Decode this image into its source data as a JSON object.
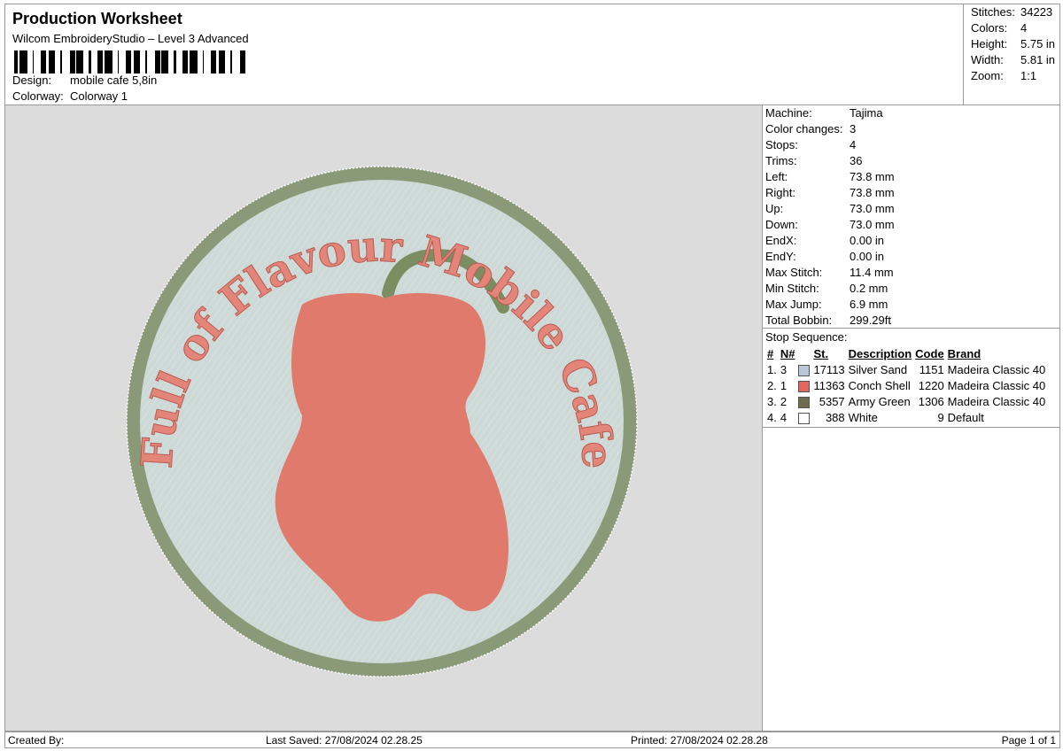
{
  "header": {
    "title": "Production Worksheet",
    "software": "Wilcom EmbroideryStudio – Level 3 Advanced",
    "design_label": "Design:",
    "design_value": "mobile cafe 5,8in",
    "colorway_label": "Colorway:",
    "colorway_value": "Colorway 1"
  },
  "stats": [
    {
      "label": "Stitches:",
      "value": "34223"
    },
    {
      "label": "Colors:",
      "value": "4"
    },
    {
      "label": "Height:",
      "value": "5.75 in"
    },
    {
      "label": "Width:",
      "value": "5.81 in"
    },
    {
      "label": "Zoom:",
      "value": "1:1"
    }
  ],
  "machine": [
    {
      "label": "Machine:",
      "value": "Tajima"
    },
    {
      "label": "Color changes:",
      "value": "3"
    },
    {
      "label": "Stops:",
      "value": "4"
    },
    {
      "label": "Trims:",
      "value": "36"
    },
    {
      "label": "Left:",
      "value": "73.8 mm"
    },
    {
      "label": "Right:",
      "value": "73.8 mm"
    },
    {
      "label": "Up:",
      "value": "73.0 mm"
    },
    {
      "label": "Down:",
      "value": "73.0 mm"
    },
    {
      "label": "EndX:",
      "value": "0.00 in"
    },
    {
      "label": "EndY:",
      "value": "0.00 in"
    },
    {
      "label": "Max Stitch:",
      "value": "11.4 mm"
    },
    {
      "label": "Min Stitch:",
      "value": "0.2 mm"
    },
    {
      "label": "Max Jump:",
      "value": "6.9 mm"
    },
    {
      "label": "Total Bobbin:",
      "value": "299.29ft"
    }
  ],
  "stop_sequence": {
    "title": "Stop Sequence:",
    "headers": {
      "idx": "#",
      "n": "N#",
      "st": "St.",
      "desc": "Description",
      "code": "Code",
      "brand": "Brand"
    },
    "rows": [
      {
        "idx": "1.",
        "n": "3",
        "color": "#b9c7d8",
        "st": "17113",
        "desc": "Silver Sand",
        "code": "1151",
        "brand": "Madeira Classic 40"
      },
      {
        "idx": "2.",
        "n": "1",
        "color": "#e2665e",
        "st": "11363",
        "desc": "Conch Shell",
        "code": "1220",
        "brand": "Madeira Classic 40"
      },
      {
        "idx": "3.",
        "n": "2",
        "color": "#6d6d4d",
        "st": "5357",
        "desc": "Army Green",
        "code": "1306",
        "brand": "Madeira Classic 40"
      },
      {
        "idx": "4.",
        "n": "4",
        "color": "#ffffff",
        "st": "388",
        "desc": "White",
        "code": "9",
        "brand": "Default"
      }
    ]
  },
  "design": {
    "arc_text": "Full of Flavour Mobile Cafe",
    "colors": {
      "background": "#dcdcdc",
      "fill": "#cdd9d6",
      "border": "#8a9a78",
      "pepper": "#e07a6c",
      "stem": "#7b8e62",
      "text": "#e4857a"
    }
  },
  "footer": {
    "created_by": "Created By:",
    "last_saved": "Last Saved: 27/08/2024 02.28.25",
    "printed": "Printed: 27/08/2024 02.28.28",
    "page": "Page 1 of 1"
  }
}
